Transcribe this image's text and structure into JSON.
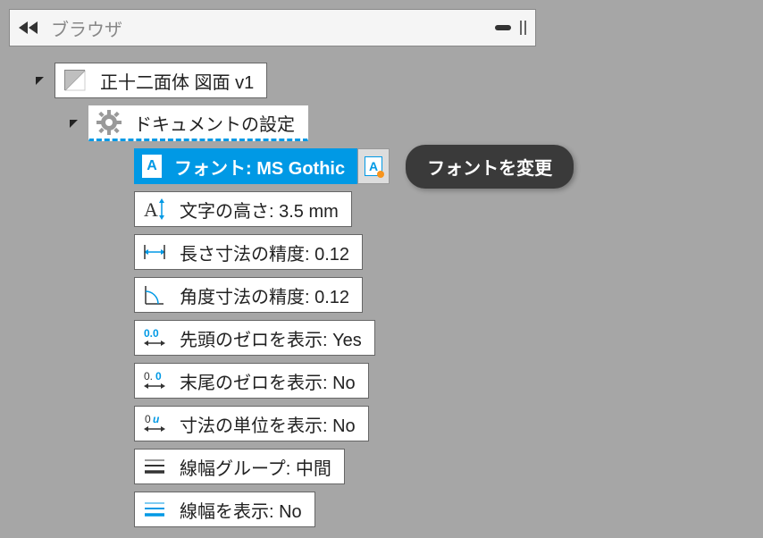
{
  "browser": {
    "title": "ブラウザ"
  },
  "tree": {
    "root": {
      "label": "正十二面体 図面 v1"
    },
    "docSettings": {
      "label": "ドキュメントの設定"
    },
    "font": {
      "label": "フォント: MS Gothic"
    },
    "tooltip": "フォントを変更",
    "items": [
      {
        "label": "文字の高さ: 3.5 mm",
        "icon": "text-height"
      },
      {
        "label": "長さ寸法の精度: 0.12",
        "icon": "dimension-length"
      },
      {
        "label": "角度寸法の精度: 0.12",
        "icon": "dimension-angle"
      },
      {
        "label": "先頭のゼロを表示: Yes",
        "icon": "leading-zero"
      },
      {
        "label": "末尾のゼロを表示: No",
        "icon": "trailing-zero"
      },
      {
        "label": "寸法の単位を表示: No",
        "icon": "units"
      },
      {
        "label": "線幅グループ: 中間",
        "icon": "lineweight-group"
      },
      {
        "label": "線幅を表示: No",
        "icon": "lineweight-show"
      }
    ]
  }
}
